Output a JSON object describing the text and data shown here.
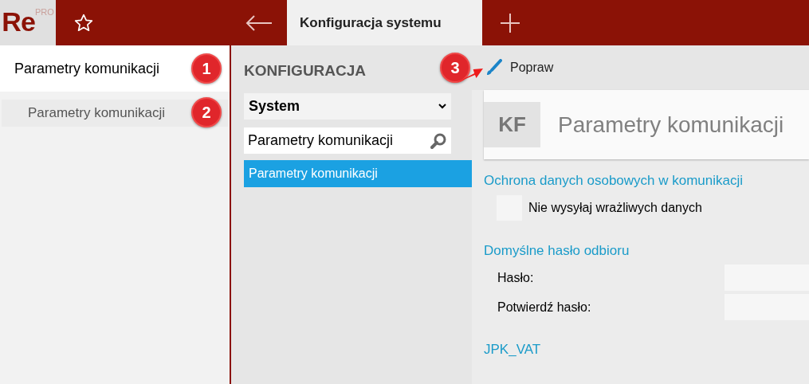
{
  "top_bar": {
    "logo": {
      "text": "Re",
      "superscript": "PRO"
    },
    "tab": {
      "label": "Konfiguracja systemu",
      "selected": true
    }
  },
  "sidebar": {
    "items": [
      {
        "label": "Parametry komunikacji",
        "selected": true
      },
      {
        "label": "Parametry komunikacji",
        "selected": false
      }
    ]
  },
  "navigator": {
    "title": "KONFIGURACJA",
    "dropdown": {
      "value": "System"
    },
    "search": {
      "value": "Parametry komunikacji"
    },
    "results": [
      {
        "label": "Parametry komunikacji",
        "selected": true
      }
    ]
  },
  "toolbar": {
    "edit_button": "Popraw"
  },
  "header": {
    "badge": "KF",
    "title": "Parametry komunikacji"
  },
  "sections": [
    {
      "title": "Ochrona danych osobowych w komunikacji",
      "fields": [
        {
          "kind": "checkbox",
          "label": "Nie wysyłaj wrażliwych danych",
          "checked": false
        }
      ]
    },
    {
      "title": "Domyślne hasło odbioru",
      "fields": [
        {
          "kind": "text",
          "label": "Hasło:"
        },
        {
          "kind": "text",
          "label": "Potwierdź hasło:"
        }
      ]
    },
    {
      "title": "JPK_VAT"
    }
  ],
  "annotations": [
    "1",
    "2",
    "3"
  ]
}
